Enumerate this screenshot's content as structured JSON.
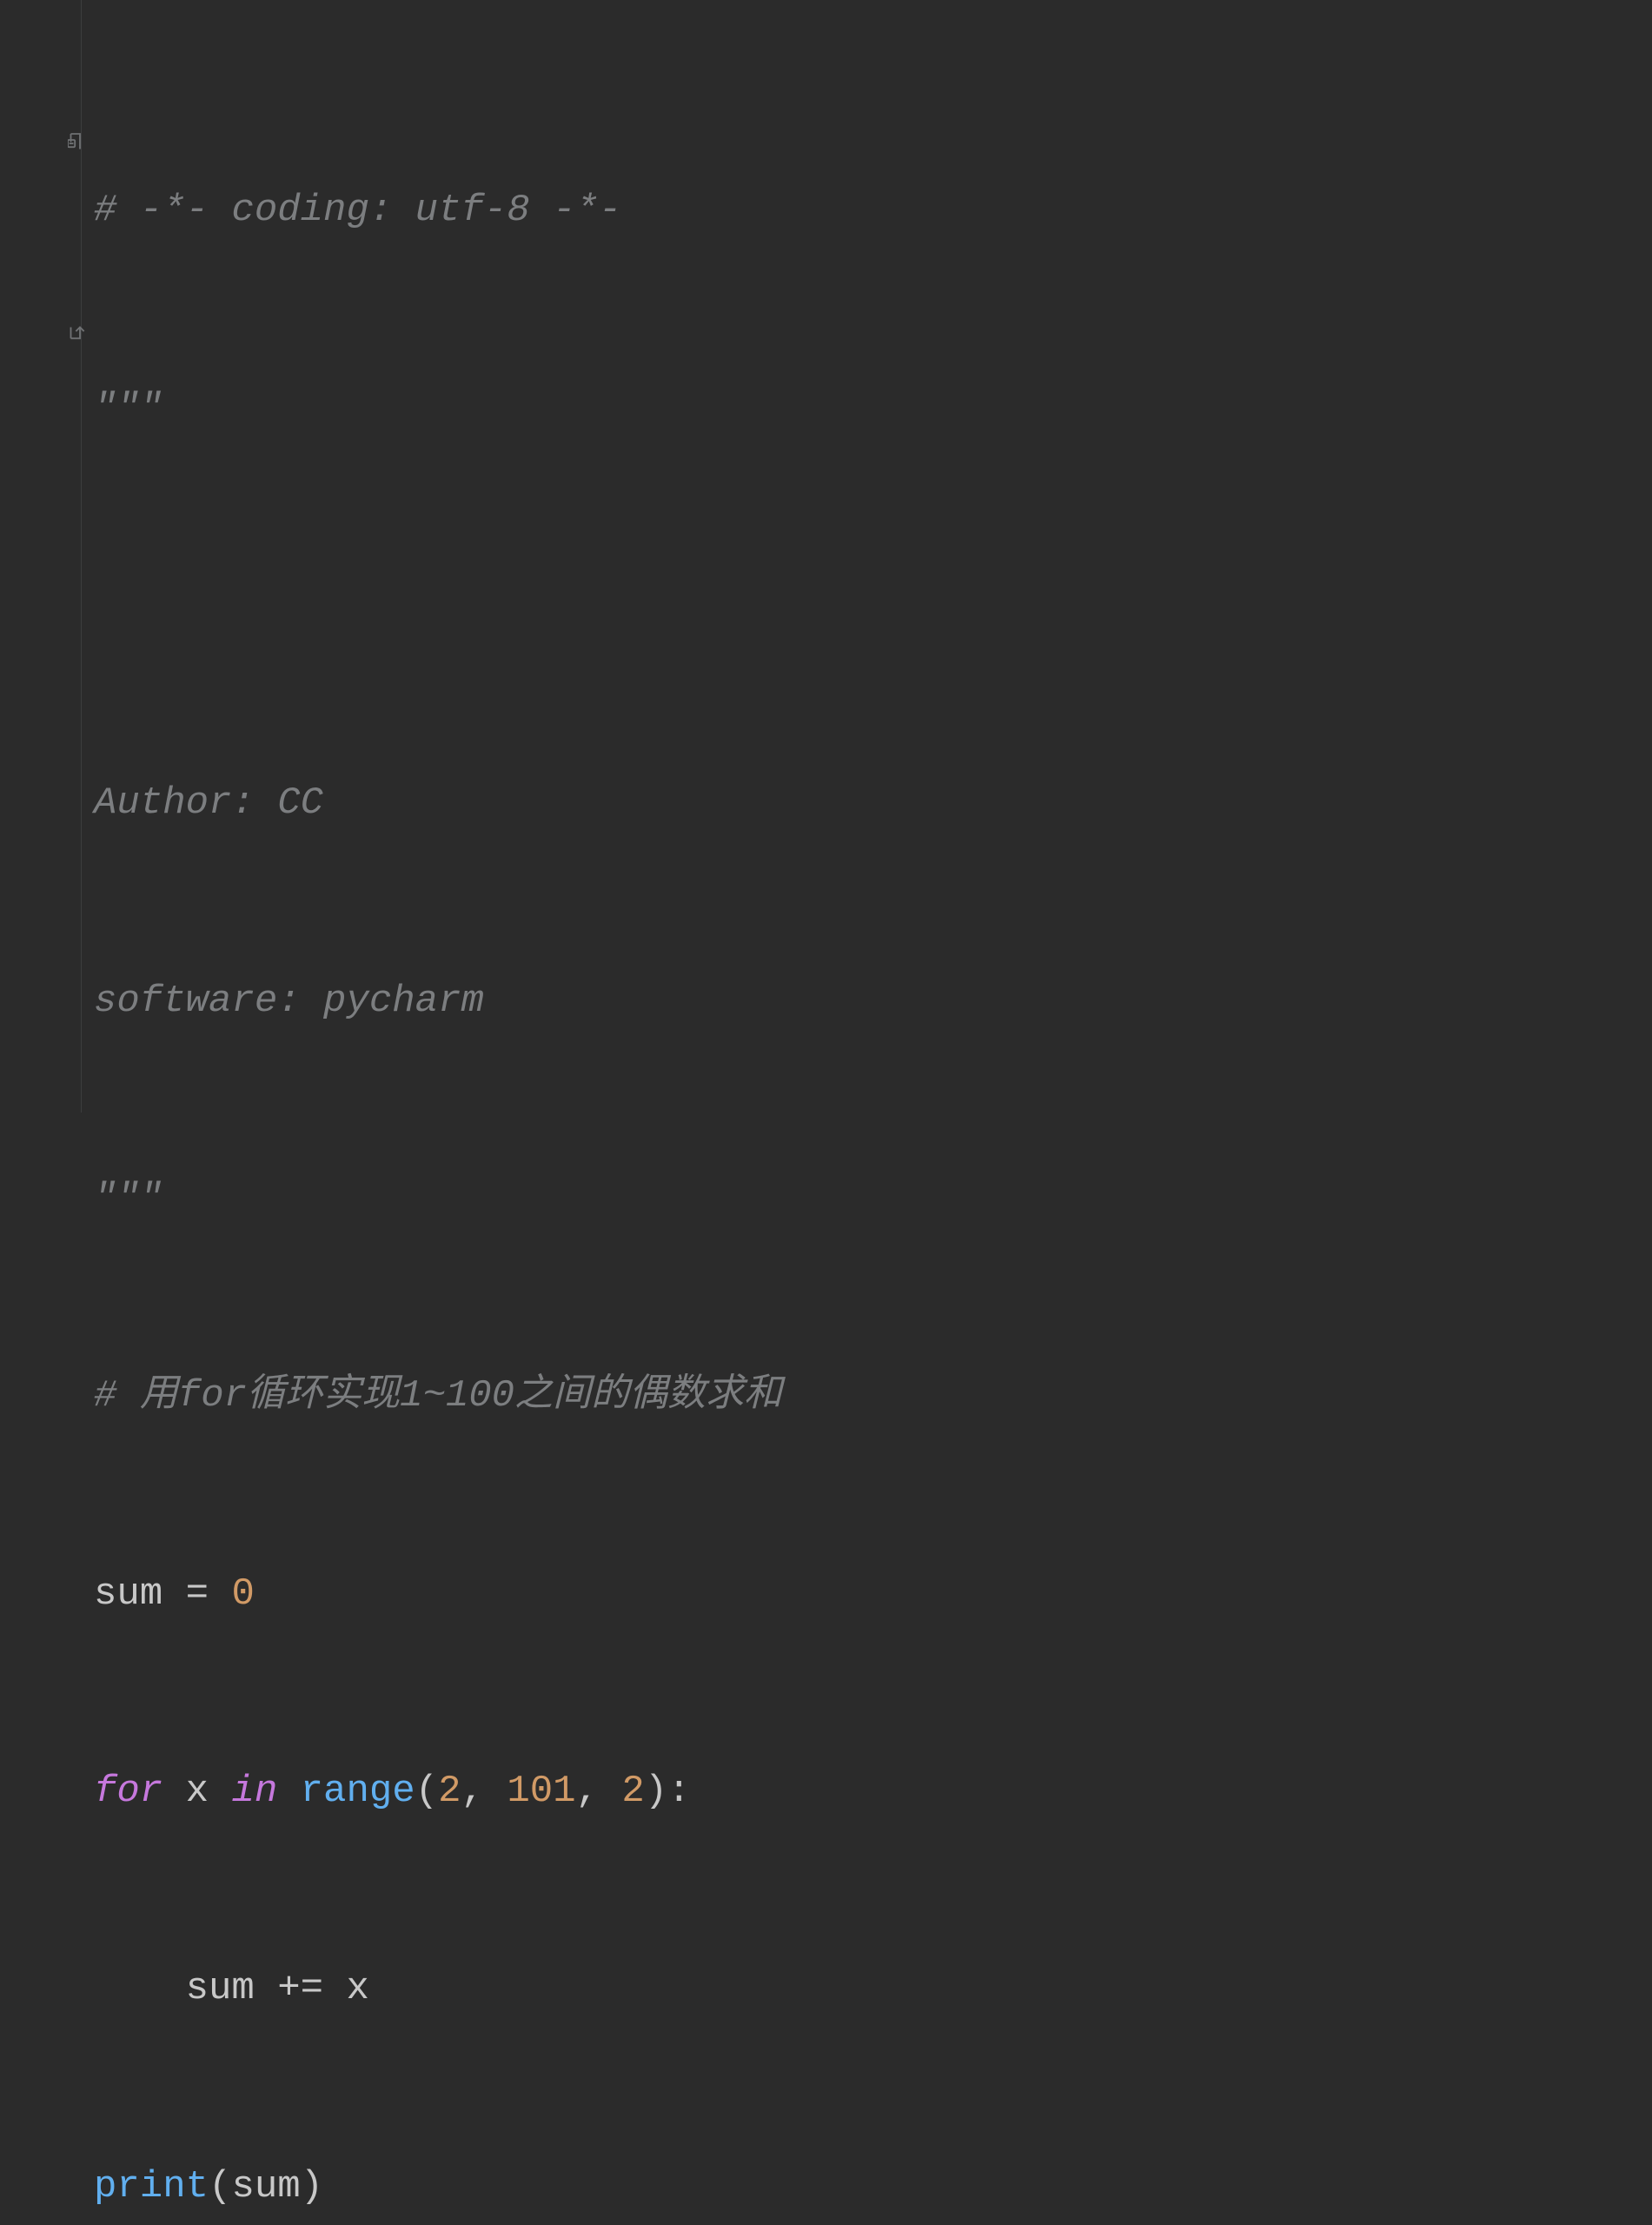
{
  "code": {
    "line1_comment": "# -*- coding: utf-8 -*-",
    "line2_docopen": "\"\"\"",
    "line4_author": "Author: CC",
    "line5_software": "software: pycharm",
    "line6_docclose": "\"\"\"",
    "line7_comment": "# 用for循环实现1~100之间的偶数求和",
    "line8_sum": "sum",
    "line8_eq": " = ",
    "line8_zero": "0",
    "line9_for": "for",
    "line9_x": " x ",
    "line9_in": "in",
    "line9_sp": " ",
    "line9_range": "range",
    "line9_p1": "(",
    "line9_a1": "2",
    "line9_c1": ", ",
    "line9_a2": "101",
    "line9_c2": ", ",
    "line9_a3": "2",
    "line9_p2": ")",
    "line9_colon": ":",
    "line10_indent": "    ",
    "line10_sum": "sum",
    "line10_op": " += ",
    "line10_x": "x",
    "line11_print": "print",
    "line11_p1": "(",
    "line11_arg": "sum",
    "line11_p2": ")"
  }
}
